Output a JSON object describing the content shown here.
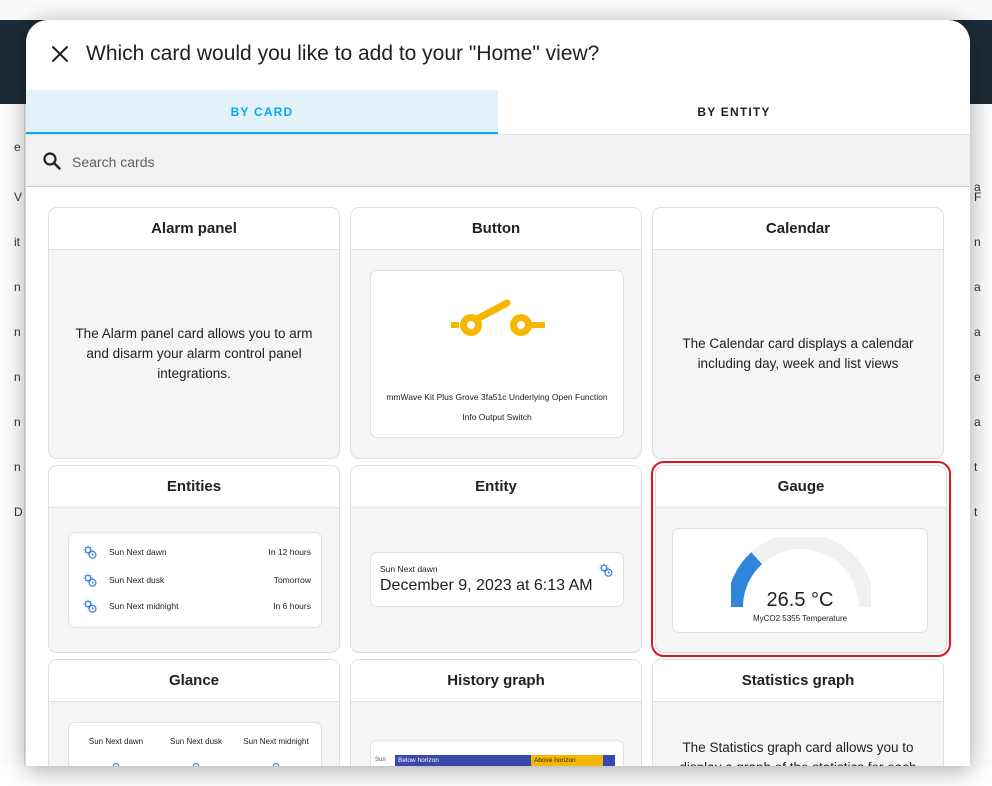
{
  "dialog": {
    "title": "Which card would you like to add to your \"Home\" view?",
    "tabs": [
      {
        "label": "BY CARD",
        "active": true
      },
      {
        "label": "BY ENTITY",
        "active": false
      }
    ],
    "search": {
      "placeholder": "Search cards",
      "value": ""
    }
  },
  "cards": {
    "alarm_panel": {
      "title": "Alarm panel",
      "description": "The Alarm panel card allows you to arm and disarm your alarm control panel integrations."
    },
    "button": {
      "title": "Button",
      "entity_name": "mmWave Kit Plus Grove 3fa51c Underlying Open Function Info Output Switch",
      "icon": "toggle-switch-icon"
    },
    "calendar": {
      "title": "Calendar",
      "description": "The Calendar card displays a calendar including day, week and list views"
    },
    "entities": {
      "title": "Entities",
      "rows": [
        {
          "name": "Sun Next dawn",
          "value": "In 12 hours",
          "icon": "sun-clock-icon"
        },
        {
          "name": "Sun Next dusk",
          "value": "Tomorrow",
          "icon": "sun-clock-icon"
        },
        {
          "name": "Sun Next midnight",
          "value": "In 6 hours",
          "icon": "sun-clock-icon"
        }
      ]
    },
    "entity": {
      "title": "Entity",
      "name": "Sun Next dawn",
      "state": "December 9, 2023 at 6:13 AM",
      "icon": "sun-clock-icon"
    },
    "gauge": {
      "title": "Gauge",
      "value_text": "26.5 °C",
      "value": 26.5,
      "min": 0,
      "max": 100,
      "name": "MyCO2 5355 Temperature"
    },
    "glance": {
      "title": "Glance",
      "items": [
        "Sun Next dawn",
        "Sun Next dusk",
        "Sun Next midnight"
      ]
    },
    "history_graph": {
      "title": "History graph",
      "row_label": "Sun",
      "segments": [
        "Below horizon",
        "Above horizon"
      ]
    },
    "statistics_graph": {
      "title": "Statistics graph",
      "description": "The Statistics graph card allows you to display a graph of the statistics for each"
    }
  },
  "backdrop": {
    "left_letters": [
      "e",
      "V",
      "it",
      "n",
      "n",
      "n",
      "n",
      "n",
      "D"
    ],
    "right_letters": [
      "a",
      "F",
      "n",
      "a",
      "a",
      "e",
      "a",
      "t",
      "t"
    ]
  },
  "colors": {
    "accent": "#03a9f4",
    "tab_active_bg": "#e3f1fb",
    "button_icon": "#f5b700",
    "gauge_fill": "#2f86dc",
    "gauge_track": "#f0f0f0",
    "selection": "#e0141e",
    "history_below": "#3949ab",
    "history_above": "#f5b700"
  }
}
